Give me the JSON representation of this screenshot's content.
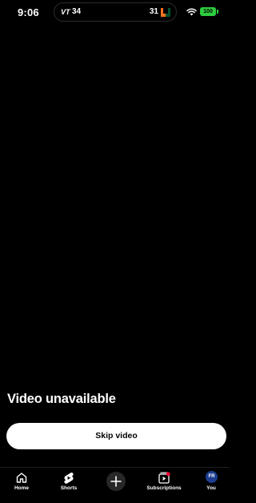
{
  "status_bar": {
    "time": "9:06",
    "live_activity": {
      "left_team_logo": "VT",
      "left_score": "34",
      "right_score": "31",
      "right_team_logo": "U"
    },
    "battery_level": "100",
    "battery_color": "#2ecc40"
  },
  "player": {
    "message": "Video unavailable",
    "skip_label": "Skip video"
  },
  "nav": {
    "items": [
      {
        "label": "Home",
        "icon": "home-icon"
      },
      {
        "label": "Shorts",
        "icon": "shorts-icon"
      },
      {
        "label": "",
        "icon": "plus-icon"
      },
      {
        "label": "Subscriptions",
        "icon": "subscriptions-icon"
      },
      {
        "label": "You",
        "icon": "avatar"
      }
    ],
    "avatar_text": "FR"
  }
}
